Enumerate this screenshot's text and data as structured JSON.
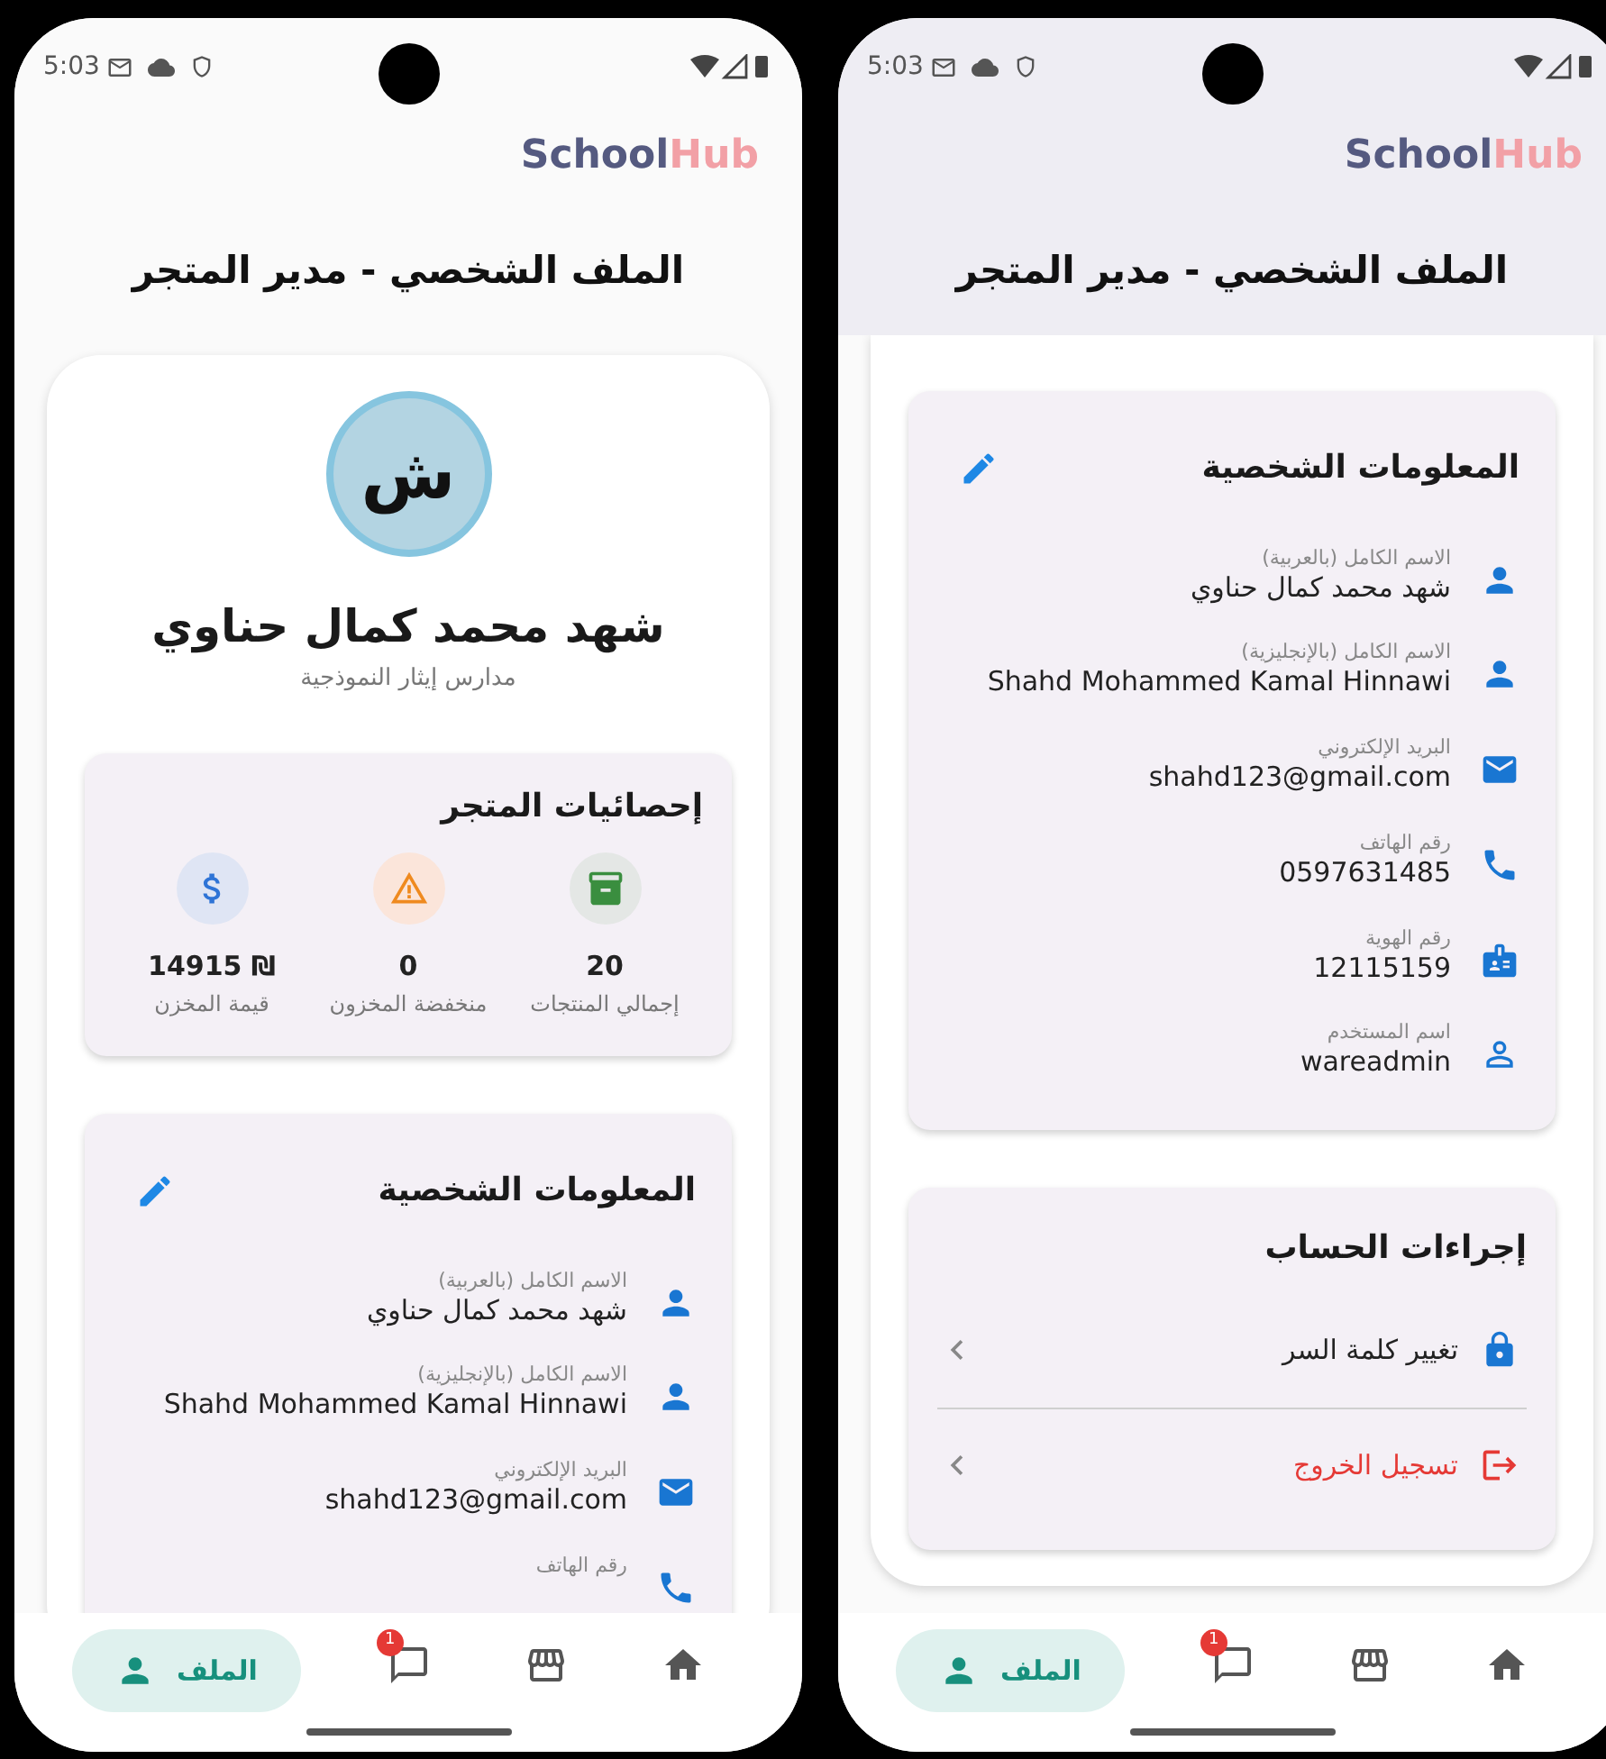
{
  "screens": [
    {
      "status_bar": {
        "time": "5:03"
      },
      "logo": {
        "part_1": "School",
        "part_2": "Hub"
      },
      "title": "الملف الشخصي - مدير المتجر",
      "scrolled": true,
      "sections": [
        {
          "kind": "info",
          "title": "المعلومات الشخصية",
          "fields": [
            {
              "kind": "person",
              "label": "الاسم الكامل (بالعربية)",
              "value": "شهد محمد كمال حناوي"
            },
            {
              "kind": "person",
              "label": "الاسم الكامل (بالإنجليزية)",
              "value": "Shahd Mohammed Kamal Hinnawi"
            },
            {
              "kind": "mail",
              "label": "البريد الإلكتروني",
              "value": "shahd123@gmail.com"
            },
            {
              "kind": "phone",
              "label": "رقم الهاتف",
              "value": "0597631485"
            },
            {
              "kind": "id",
              "label": "رقم الهوية",
              "value": "12115159"
            },
            {
              "kind": "username",
              "label": "اسم المستخدم",
              "value": "wareadmin"
            }
          ]
        },
        {
          "kind": "actions",
          "title": "إجراءات الحساب",
          "items": [
            {
              "kind": "lock",
              "label": "تغيير كلمة السر",
              "danger": false
            },
            {
              "kind": "logout",
              "label": "تسجيل الخروج",
              "danger": true
            }
          ]
        }
      ],
      "nav": [
        {
          "kind": "home",
          "selected": false
        },
        {
          "kind": "store",
          "selected": false
        },
        {
          "kind": "chat",
          "badge": "1",
          "selected": false
        },
        {
          "kind": "profile",
          "label": "الملف",
          "selected": true
        }
      ]
    },
    {
      "status_bar": {
        "time": "5:03"
      },
      "logo": {
        "part_1": "School",
        "part_2": "Hub"
      },
      "title": "الملف الشخصي - مدير المتجر",
      "scrolled": false,
      "sections": [
        {
          "kind": "profile",
          "avatar": "ش",
          "name": "شهد محمد كمال حناوي",
          "school": "مدارس إيثار النموذجية"
        },
        {
          "kind": "stats",
          "title": "إحصائيات المتجر",
          "items": [
            {
              "kind": "products",
              "value": "20",
              "label": "إجمالي المنتجات"
            },
            {
              "kind": "low_stock",
              "value": "0",
              "label": "منخفضة المخزون"
            },
            {
              "kind": "value",
              "value": "₪ 14915",
              "label": "قيمة المخزن"
            }
          ]
        },
        {
          "kind": "info",
          "title": "المعلومات الشخصية",
          "fields": [
            {
              "kind": "person",
              "label": "الاسم الكامل (بالعربية)",
              "value": "شهد محمد كمال حناوي"
            },
            {
              "kind": "person",
              "label": "الاسم الكامل (بالإنجليزية)",
              "value": "Shahd Mohammed Kamal Hinnawi"
            },
            {
              "kind": "mail",
              "label": "البريد الإلكتروني",
              "value": "shahd123@gmail.com"
            },
            {
              "kind": "phone",
              "label": "رقم الهاتف"
            }
          ]
        }
      ],
      "nav": [
        {
          "kind": "home",
          "selected": false
        },
        {
          "kind": "store",
          "selected": false
        },
        {
          "kind": "chat",
          "badge": "1",
          "selected": false
        },
        {
          "kind": "profile",
          "label": "الملف",
          "selected": true
        }
      ]
    }
  ]
}
